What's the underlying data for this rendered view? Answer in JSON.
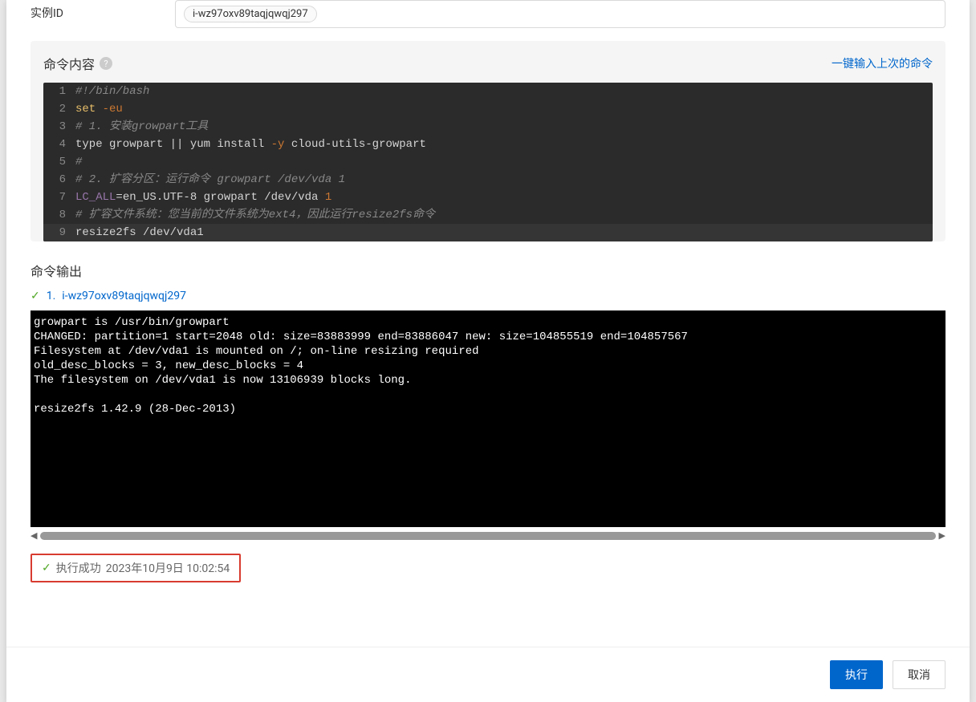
{
  "form": {
    "instance_id_label": "实例ID",
    "instance_id_value": "i-wz97oxv89taqjqwqj297"
  },
  "command_section": {
    "title": "命令内容",
    "help_glyph": "?",
    "input_last_command": "一键输入上次的命令",
    "code": {
      "l1": "#!/bin/bash",
      "l2_set": "set",
      "l2_flag": " -eu",
      "l3": "# 1. 安装growpart工具",
      "l4a": "type growpart || yum install ",
      "l4b": "-y",
      "l4c": " cloud-utils-growpart",
      "l5": "#",
      "l6": "# 2. 扩容分区：运行命令 growpart /dev/vda 1",
      "l7a": "LC_ALL",
      "l7b": "=en_US.UTF-8 growpart /dev/vda ",
      "l7c": "1",
      "l8": "# 扩容文件系统：您当前的文件系统为ext4，因此运行resize2fs命令",
      "l9": "resize2fs /dev/vda1"
    }
  },
  "output_section": {
    "title": "命令输出",
    "instance_index": "1.",
    "instance_id": "i-wz97oxv89taqjqwqj297",
    "terminal": "growpart is /usr/bin/growpart\nCHANGED: partition=1 start=2048 old: size=83883999 end=83886047 new: size=104855519 end=104857567\nFilesystem at /dev/vda1 is mounted on /; on-line resizing required\nold_desc_blocks = 3, new_desc_blocks = 4\nThe filesystem on /dev/vda1 is now 13106939 blocks long.\n\nresize2fs 1.42.9 (28-Dec-2013)"
  },
  "status": {
    "label": "执行成功",
    "timestamp": "2023年10月9日 10:02:54"
  },
  "footer": {
    "execute": "执行",
    "cancel": "取消"
  }
}
